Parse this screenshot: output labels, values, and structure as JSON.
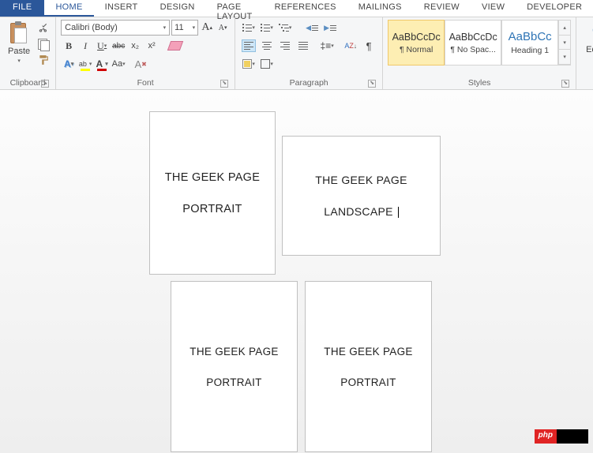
{
  "tabs": {
    "file": "FILE",
    "home": "HOME",
    "insert": "INSERT",
    "design": "DESIGN",
    "pageLayout": "PAGE LAYOUT",
    "references": "REFERENCES",
    "mailings": "MAILINGS",
    "review": "REVIEW",
    "view": "VIEW",
    "developer": "DEVELOPER"
  },
  "clipboard": {
    "paste": "Paste",
    "label": "Clipboard"
  },
  "font": {
    "name": "Calibri (Body)",
    "size": "11",
    "grow": "A",
    "shrink": "A",
    "bold": "B",
    "italic": "I",
    "underline": "U",
    "strike": "abc",
    "sub": "x₂",
    "sup": "x²",
    "effects": "A",
    "highlight": "ab",
    "color": "A",
    "case": "Aa",
    "clear": "A",
    "label": "Font"
  },
  "paragraph": {
    "label": "Paragraph",
    "sort": "A↓",
    "pilcrow": "¶"
  },
  "styles": {
    "preview": "AaBbCcDc",
    "previewH1": "AaBbCc",
    "normal": "¶ Normal",
    "nospacing": "¶ No Spac...",
    "heading1": "Heading 1",
    "label": "Styles"
  },
  "editing": {
    "label": "Editing"
  },
  "pages": {
    "p1": {
      "line1": "THE GEEK PAGE",
      "line2": "PORTRAIT"
    },
    "p2": {
      "line1": "THE GEEK PAGE",
      "line2": "LANDSCAPE"
    },
    "p3": {
      "line1": "THE GEEK PAGE",
      "line2": "PORTRAIT"
    },
    "p4": {
      "line1": "THE GEEK PAGE",
      "line2": "PORTRAIT"
    }
  },
  "watermark": "php"
}
